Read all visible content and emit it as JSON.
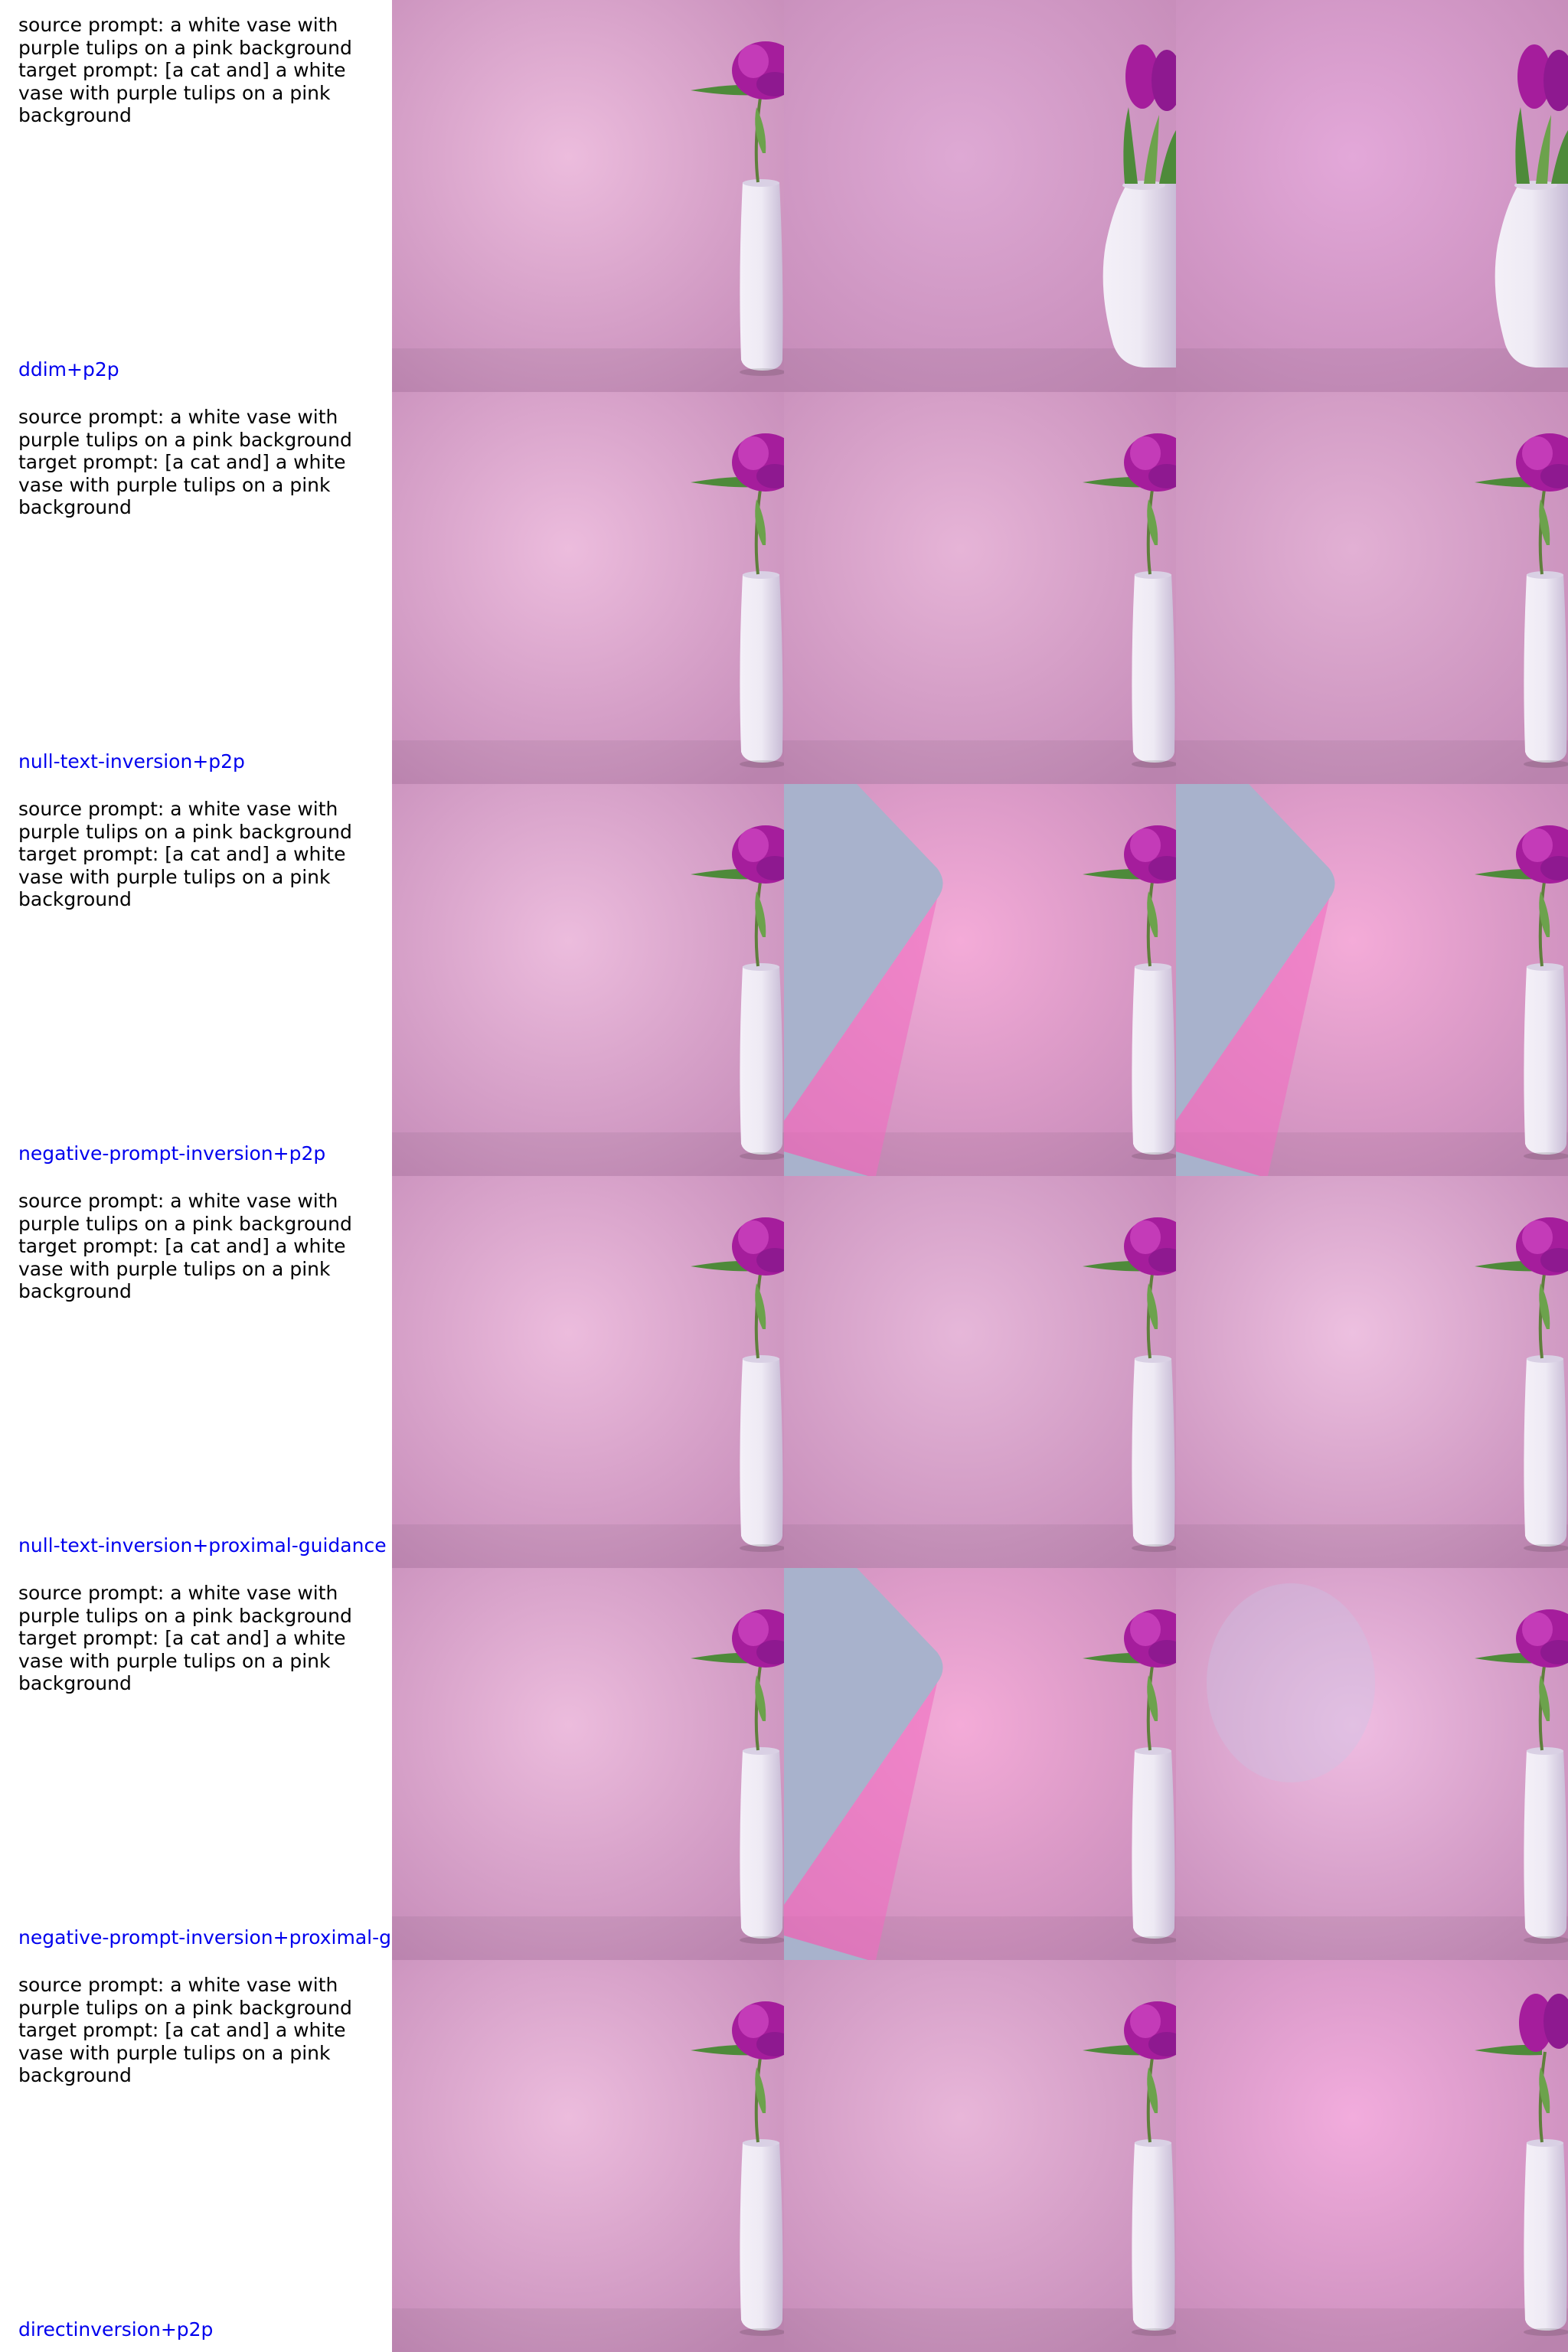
{
  "rows": [
    {
      "source_prompt": "source prompt: a white vase with purple tulips on a pink background",
      "target_prompt": "target prompt: [a cat and] a white vase with purple tulips on a pink background",
      "method": "ddim+p2p",
      "images": [
        {
          "bg": "#ecbcdd",
          "vase": "slim",
          "flower": "peony",
          "shape": "none"
        },
        {
          "bg": "#dea9d4",
          "vase": "round",
          "flower": "tulips",
          "shape": "none"
        },
        {
          "bg": "#e3a8d9",
          "vase": "round",
          "flower": "tulips",
          "shape": "none"
        }
      ]
    },
    {
      "source_prompt": "source prompt: a white vase with purple tulips on a pink background",
      "target_prompt": "target prompt: [a cat and] a white vase with purple tulips on a pink background",
      "method": "null-text-inversion+p2p",
      "images": [
        {
          "bg": "#ecbcdd",
          "vase": "slim",
          "flower": "peony",
          "shape": "none"
        },
        {
          "bg": "#e6b4d7",
          "vase": "slim",
          "flower": "peony",
          "shape": "none"
        },
        {
          "bg": "#e2b0d4",
          "vase": "slim",
          "flower": "peony",
          "shape": "none"
        }
      ]
    },
    {
      "source_prompt": "source prompt: a white vase with purple tulips on a pink background",
      "target_prompt": "target prompt: [a cat and] a white vase with purple tulips on a pink background",
      "method": "negative-prompt-inversion+p2p",
      "images": [
        {
          "bg": "#ecbcdd",
          "vase": "slim",
          "flower": "peony",
          "shape": "none"
        },
        {
          "bg": "#f4abd8",
          "vase": "slim",
          "flower": "peony",
          "shape": "blue"
        },
        {
          "bg": "#f4abd8",
          "vase": "slim",
          "flower": "peony",
          "shape": "blue"
        }
      ]
    },
    {
      "source_prompt": "source prompt: a white vase with purple tulips on a pink background",
      "target_prompt": "target prompt: [a cat and] a white vase with purple tulips on a pink background",
      "method": "null-text-inversion+proximal-guidance",
      "images": [
        {
          "bg": "#ecbcdd",
          "vase": "slim",
          "flower": "peony",
          "shape": "none"
        },
        {
          "bg": "#e6b7d9",
          "vase": "slim",
          "flower": "peony",
          "shape": "none"
        },
        {
          "bg": "#edc0e0",
          "vase": "slim",
          "flower": "peony",
          "shape": "none"
        }
      ]
    },
    {
      "source_prompt": "source prompt: a white vase with purple tulips on a pink background",
      "target_prompt": "target prompt: [a cat and] a white vase with purple tulips on a pink background",
      "method": "negative-prompt-inversion+proximal-guidance",
      "images": [
        {
          "bg": "#ecbcdd",
          "vase": "slim",
          "flower": "peony",
          "shape": "none"
        },
        {
          "bg": "#f4abd8",
          "vase": "slim",
          "flower": "peony",
          "shape": "blue"
        },
        {
          "bg": "#efbde2",
          "vase": "slim",
          "flower": "peony",
          "shape": "haze"
        }
      ]
    },
    {
      "source_prompt": "source prompt: a white vase with purple tulips on a pink background",
      "target_prompt": "target prompt: [a cat and] a white vase with purple tulips on a pink background",
      "method": "directinversion+p2p",
      "images": [
        {
          "bg": "#ecbcdd",
          "vase": "slim",
          "flower": "peony",
          "shape": "none"
        },
        {
          "bg": "#e8b6d9",
          "vase": "slim",
          "flower": "peony",
          "shape": "none"
        },
        {
          "bg": "#f2acdd",
          "vase": "slim",
          "flower": "tulips",
          "shape": "none"
        }
      ]
    }
  ],
  "colors": {
    "method_label": "#0000ee",
    "prompt_text": "#000000",
    "vase_white": "#eeeaf4",
    "flower_purple": "#a51d9c",
    "leaf_green": "#4e8a3a",
    "blue_shape": "#a8b2cc"
  }
}
